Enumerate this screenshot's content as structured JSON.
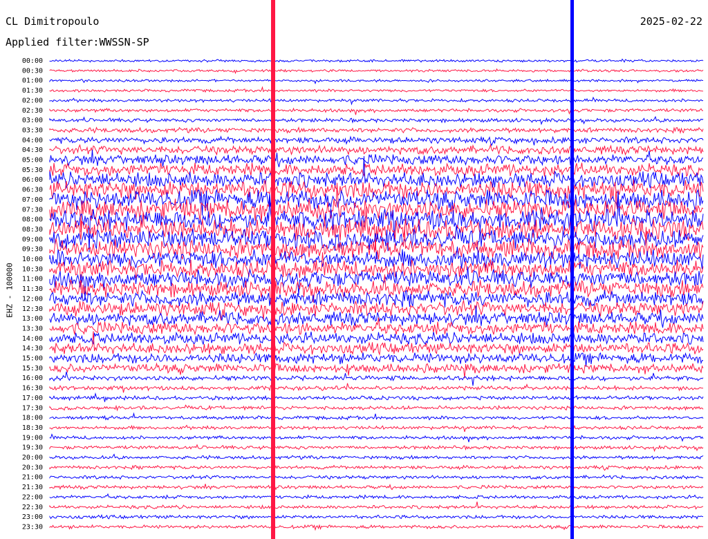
{
  "header": {
    "station": "CL Dimitropoulo",
    "filter": "Applied filter:WWSSN-SP",
    "date": "2025-02-22"
  },
  "channel_label": "EHZ - 100000",
  "colors": {
    "trace_a": "#0000ff",
    "trace_b": "#ff1744",
    "background": "#ffffff"
  },
  "chart_data": {
    "type": "line",
    "title": "CL Dimitropoulo",
    "subtitle": "Applied filter:WWSSN-SP",
    "ylabel": "EHZ - 100000",
    "rows": [
      "00:00",
      "00:30",
      "01:00",
      "01:30",
      "02:00",
      "02:30",
      "03:00",
      "03:30",
      "04:00",
      "04:30",
      "05:00",
      "05:30",
      "06:00",
      "06:30",
      "07:00",
      "07:30",
      "08:00",
      "08:30",
      "09:00",
      "09:30",
      "10:00",
      "10:30",
      "11:00",
      "11:30",
      "12:00",
      "12:30",
      "13:00",
      "13:30",
      "14:00",
      "14:30",
      "15:00",
      "15:30",
      "16:00",
      "16:30",
      "17:00",
      "17:30",
      "18:00",
      "18:30",
      "19:00",
      "19:30",
      "20:00",
      "20:30",
      "21:00",
      "21:30",
      "22:00",
      "22:30",
      "23:00",
      "23:30"
    ],
    "row_colors": [
      "blue",
      "red"
    ],
    "relative_amplitude": [
      0.35,
      0.35,
      0.35,
      0.4,
      0.45,
      0.5,
      0.55,
      0.7,
      0.9,
      1.2,
      1.5,
      1.8,
      2.2,
      2.6,
      2.8,
      2.9,
      3.0,
      2.9,
      2.8,
      2.7,
      2.6,
      2.5,
      2.4,
      2.3,
      2.2,
      2.0,
      1.9,
      1.8,
      1.7,
      1.6,
      1.5,
      1.3,
      0.7,
      0.6,
      0.55,
      0.55,
      0.5,
      0.5,
      0.5,
      0.5,
      0.5,
      0.5,
      0.5,
      0.5,
      0.5,
      0.5,
      0.5,
      0.5
    ],
    "grid": false
  }
}
